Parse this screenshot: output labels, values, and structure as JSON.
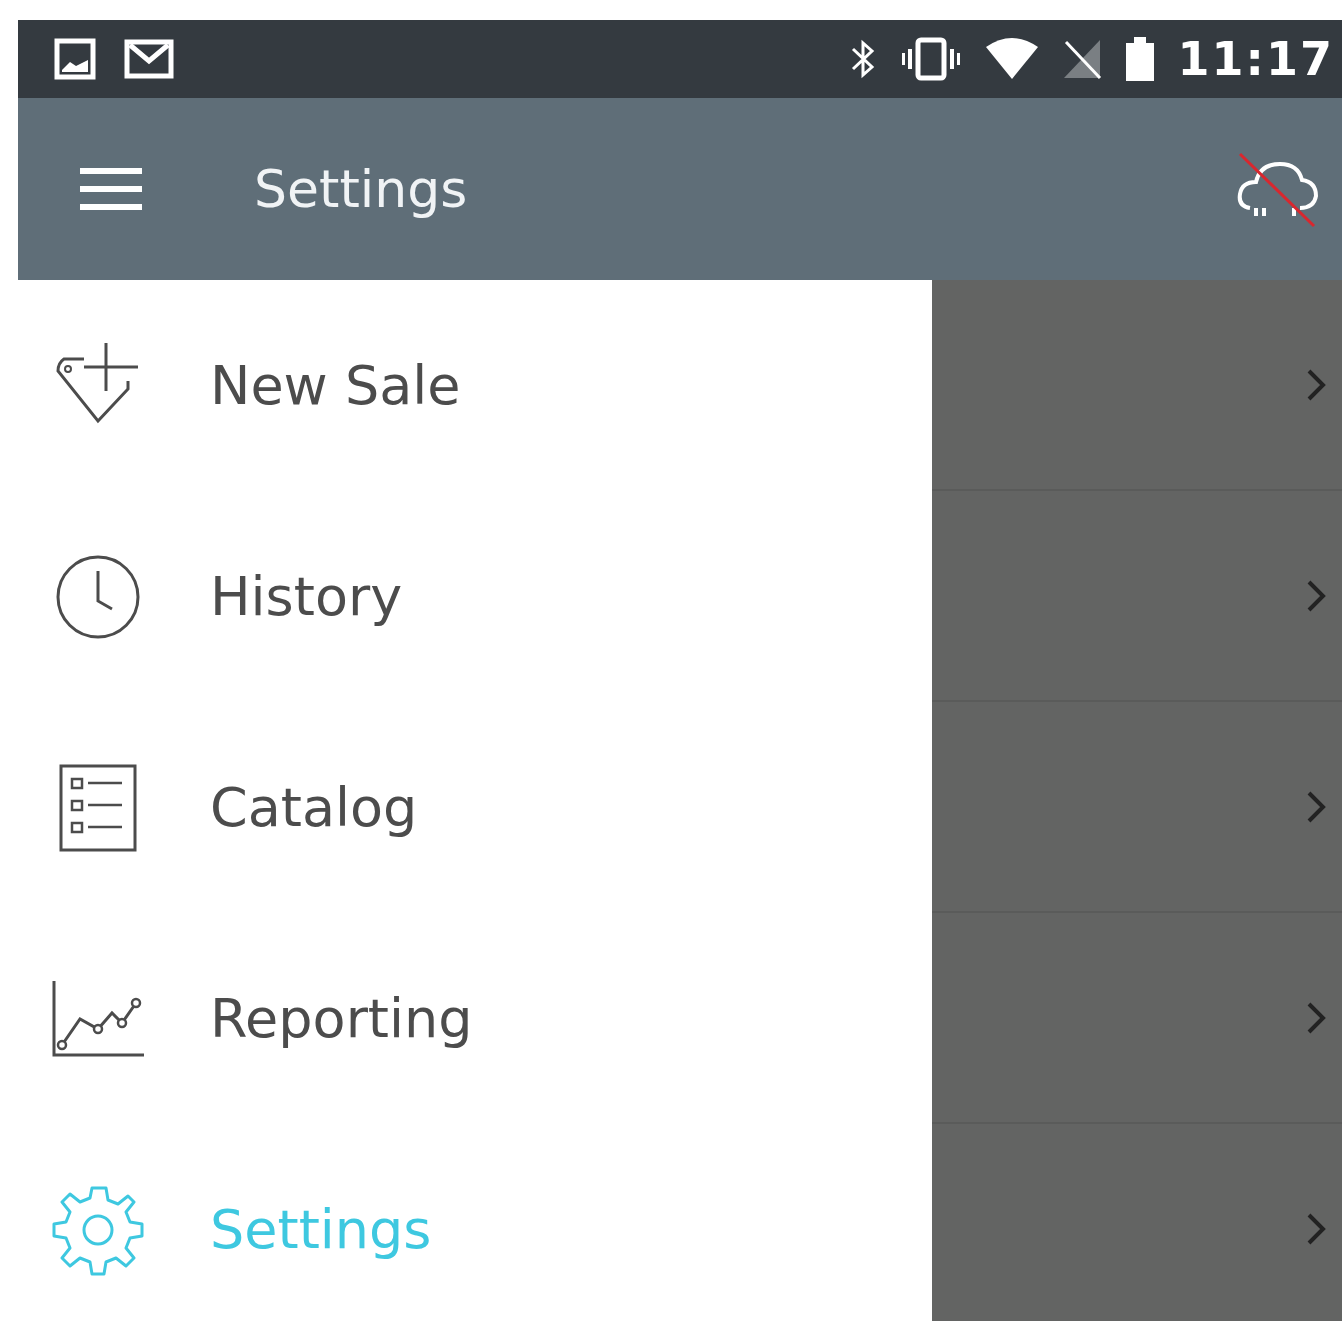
{
  "status_bar": {
    "time": "11:17"
  },
  "app_bar": {
    "title": "Settings"
  },
  "drawer": {
    "items": [
      {
        "label": "New Sale",
        "selected": false
      },
      {
        "label": "History",
        "selected": false
      },
      {
        "label": "Catalog",
        "selected": false
      },
      {
        "label": "Reporting",
        "selected": false
      },
      {
        "label": "Settings",
        "selected": true
      }
    ]
  }
}
